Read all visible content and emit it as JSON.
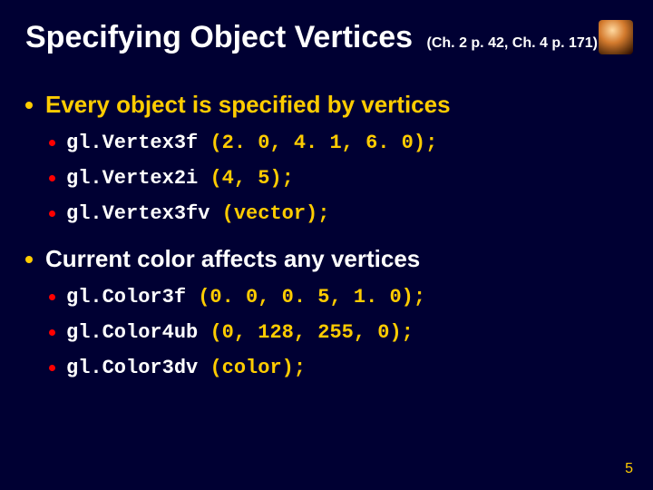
{
  "title": "Specifying Object Vertices",
  "title_sub": "(Ch. 2 p. 42, Ch. 4 p. 171)",
  "page_number": "5",
  "sections": [
    {
      "heading": "Every object is specified by vertices",
      "heading_color": "gold",
      "items": [
        {
          "fn": "gl.Vertex3f",
          "args": "(2. 0, 4. 1, 6. 0);"
        },
        {
          "fn": "gl.Vertex2i",
          "args": "(4, 5);"
        },
        {
          "fn": "gl.Vertex3fv",
          "args": "(vector);"
        }
      ]
    },
    {
      "heading": "Current color affects any vertices",
      "heading_color": "white",
      "items": [
        {
          "fn": "gl.Color3f",
          "args": "(0. 0, 0. 5, 1. 0);"
        },
        {
          "fn": "gl.Color4ub",
          "args": "(0, 128, 255, 0);"
        },
        {
          "fn": "gl.Color3dv",
          "args": "(color);"
        }
      ]
    }
  ]
}
